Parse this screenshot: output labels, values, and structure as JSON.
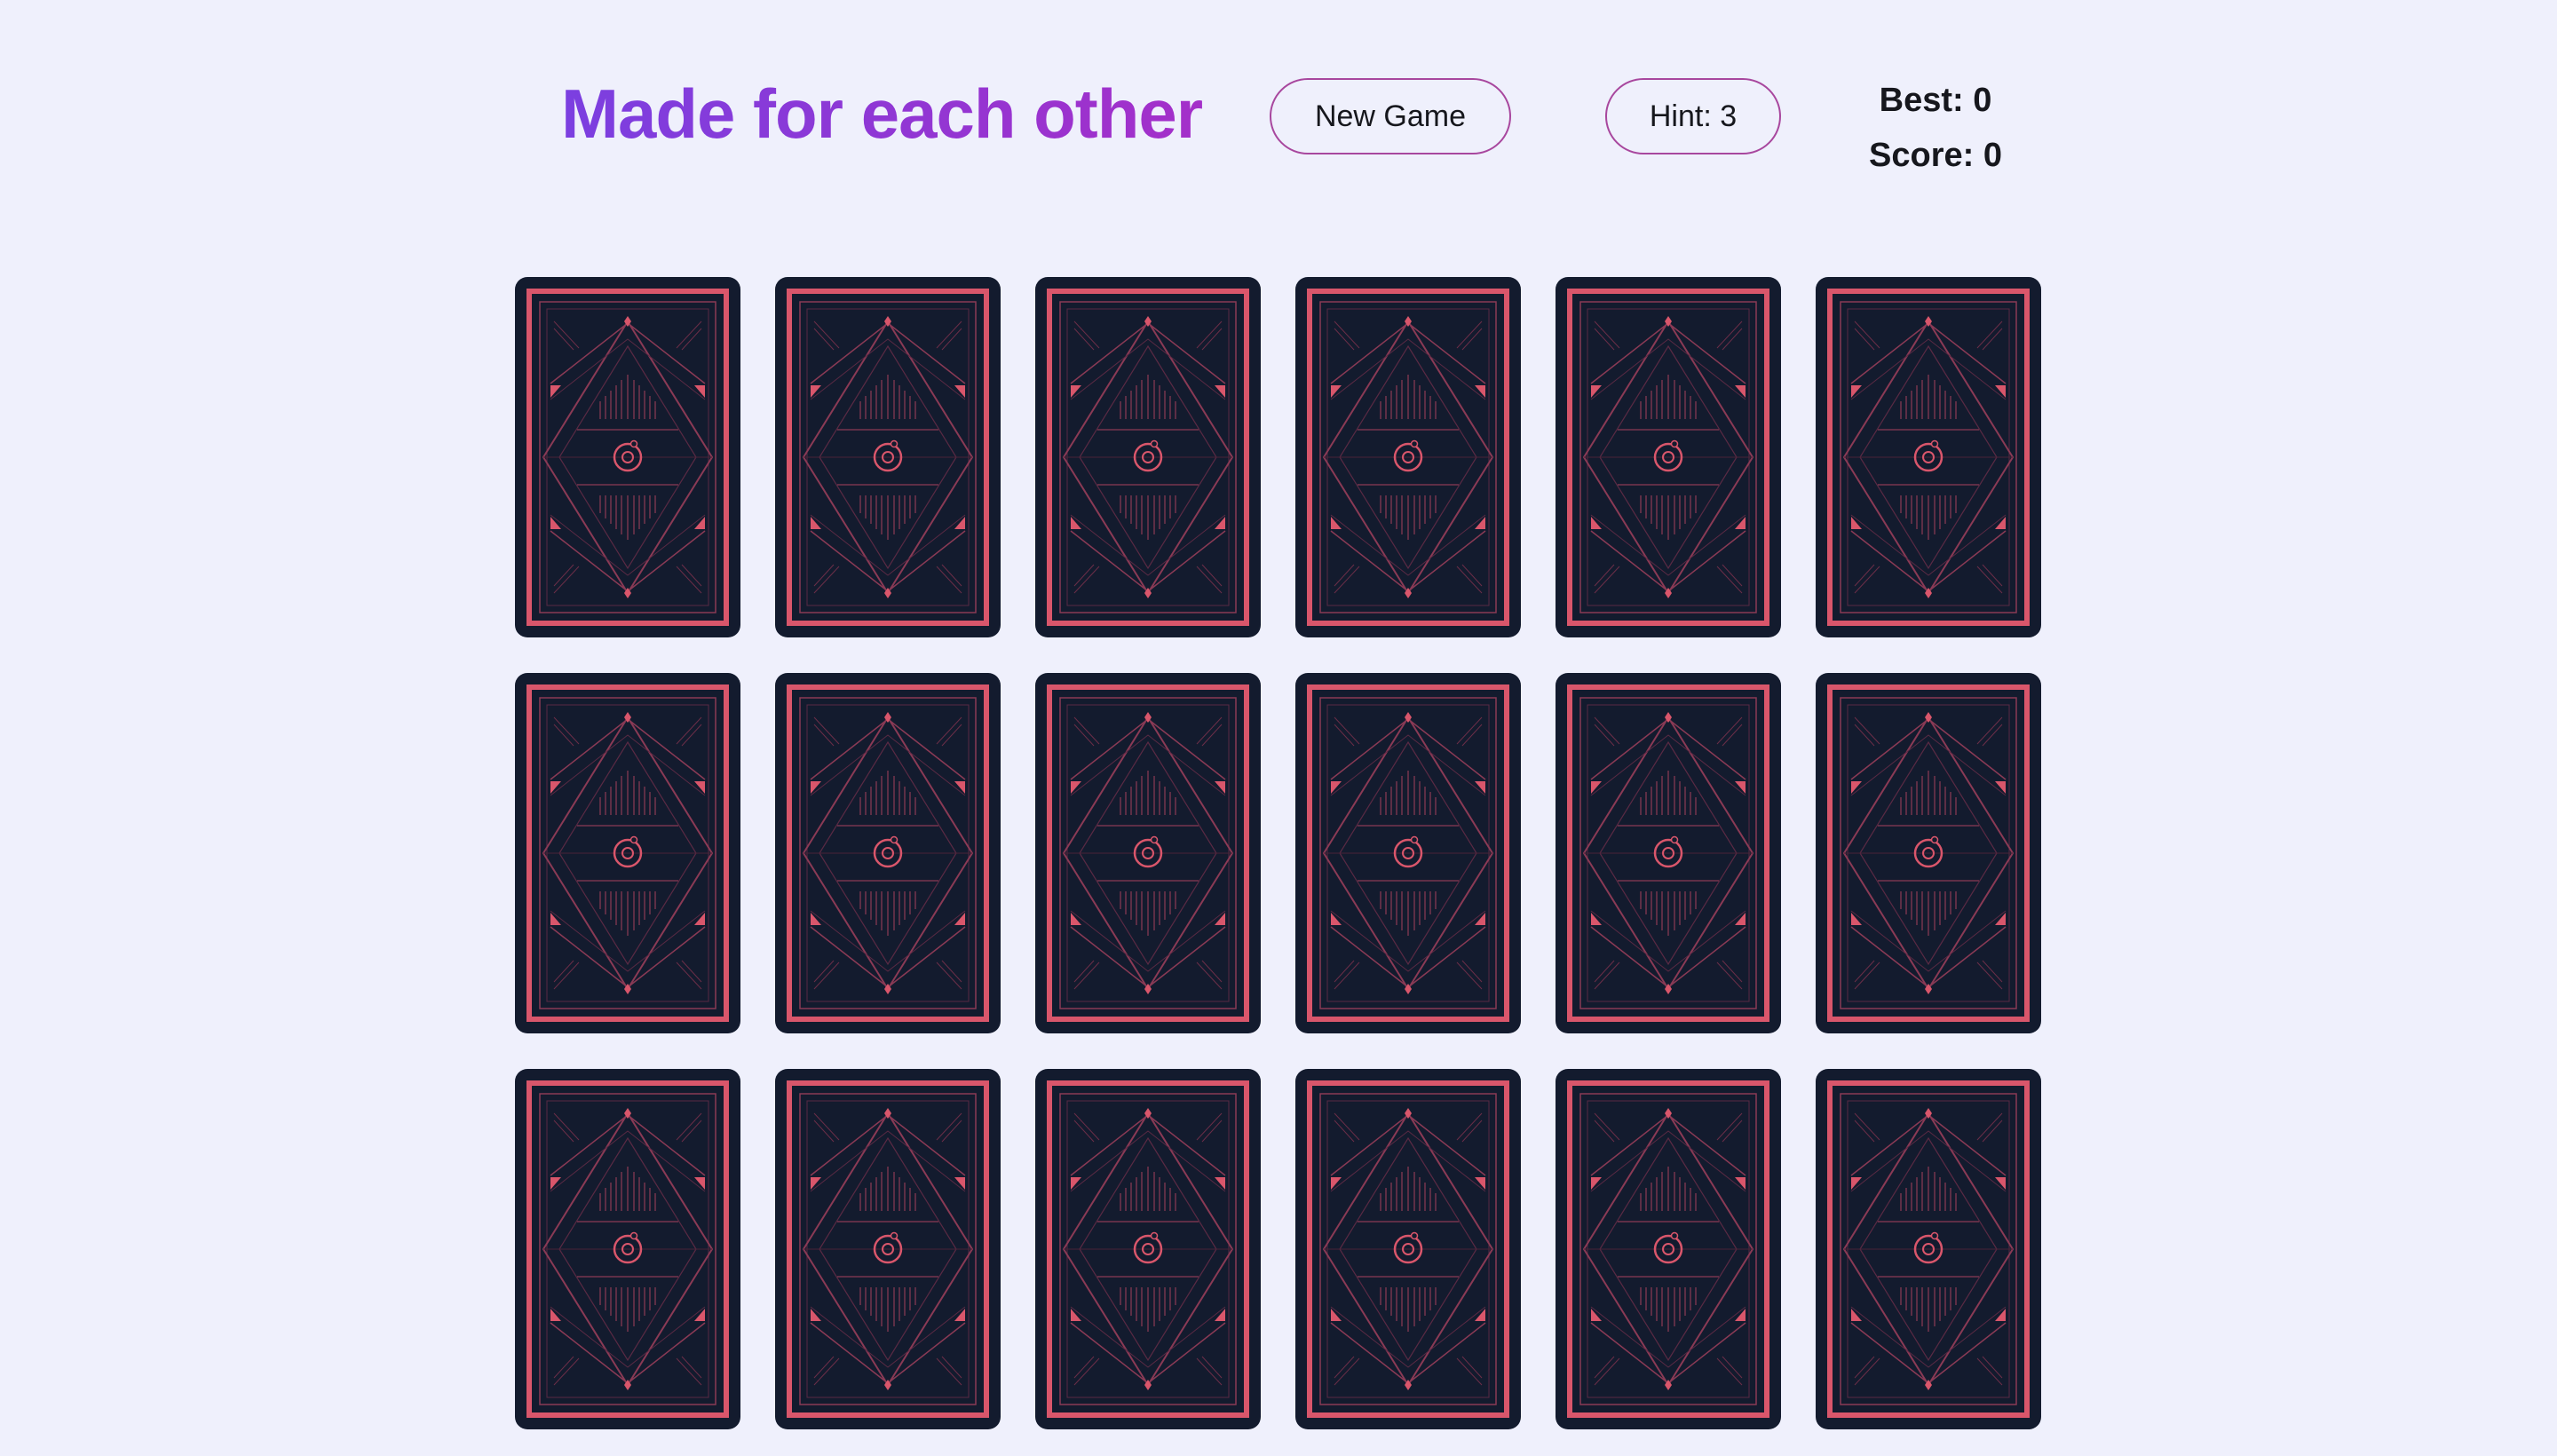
{
  "game": {
    "title": "Made for each other",
    "new_game_label": "New Game",
    "hint_label": "Hint: 3",
    "best_label": "Best: 0",
    "score_label": "Score: 0"
  },
  "board": {
    "rows": 3,
    "columns": 6,
    "card_count": 18,
    "card_state": "face-down",
    "card_back_color": "#131b2e",
    "card_accent_color": "#d9566b"
  },
  "colors": {
    "background": "#eff0fc",
    "title_gradient_start": "#7b3fe0",
    "title_gradient_end": "#a42fc9",
    "button_border": "#a8479e",
    "text": "#16171d"
  }
}
